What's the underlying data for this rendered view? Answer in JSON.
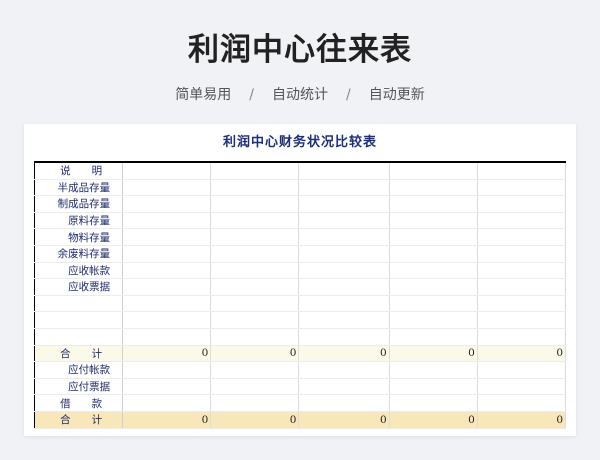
{
  "page": {
    "title": "利润中心往来表",
    "subtitle_items": [
      "简单易用",
      "自动统计",
      "自动更新"
    ],
    "separator": "/"
  },
  "sheet": {
    "title": "利润中心财务状况比较表",
    "rows": [
      {
        "label": "说　　明",
        "type": "plain",
        "values": [
          "",
          "",
          "",
          "",
          ""
        ]
      },
      {
        "label": "半成品存量",
        "type": "plain",
        "values": [
          "",
          "",
          "",
          "",
          ""
        ]
      },
      {
        "label": "制成品存量",
        "type": "plain",
        "values": [
          "",
          "",
          "",
          "",
          ""
        ]
      },
      {
        "label": "原料存量",
        "type": "plain",
        "values": [
          "",
          "",
          "",
          "",
          ""
        ]
      },
      {
        "label": "物料存量",
        "type": "plain",
        "values": [
          "",
          "",
          "",
          "",
          ""
        ]
      },
      {
        "label": "余废料存量",
        "type": "plain",
        "values": [
          "",
          "",
          "",
          "",
          ""
        ]
      },
      {
        "label": "应收帐款",
        "type": "plain",
        "values": [
          "",
          "",
          "",
          "",
          ""
        ]
      },
      {
        "label": "应收票据",
        "type": "plain",
        "values": [
          "",
          "",
          "",
          "",
          ""
        ]
      },
      {
        "label": "",
        "type": "plain",
        "values": [
          "",
          "",
          "",
          "",
          ""
        ]
      },
      {
        "label": "",
        "type": "plain",
        "values": [
          "",
          "",
          "",
          "",
          ""
        ]
      },
      {
        "label": "",
        "type": "plain",
        "values": [
          "",
          "",
          "",
          "",
          ""
        ]
      },
      {
        "label": "合　　计",
        "type": "sum1",
        "values": [
          "0",
          "0",
          "0",
          "0",
          "0"
        ]
      },
      {
        "label": "应付帐款",
        "type": "plain",
        "values": [
          "",
          "",
          "",
          "",
          ""
        ]
      },
      {
        "label": "应付票据",
        "type": "plain",
        "values": [
          "",
          "",
          "",
          "",
          ""
        ]
      },
      {
        "label": "借　　款",
        "type": "plain",
        "values": [
          "",
          "",
          "",
          "",
          ""
        ]
      },
      {
        "label": "合　　计",
        "type": "sum2",
        "values": [
          "0",
          "0",
          "0",
          "0",
          "0"
        ]
      }
    ]
  }
}
